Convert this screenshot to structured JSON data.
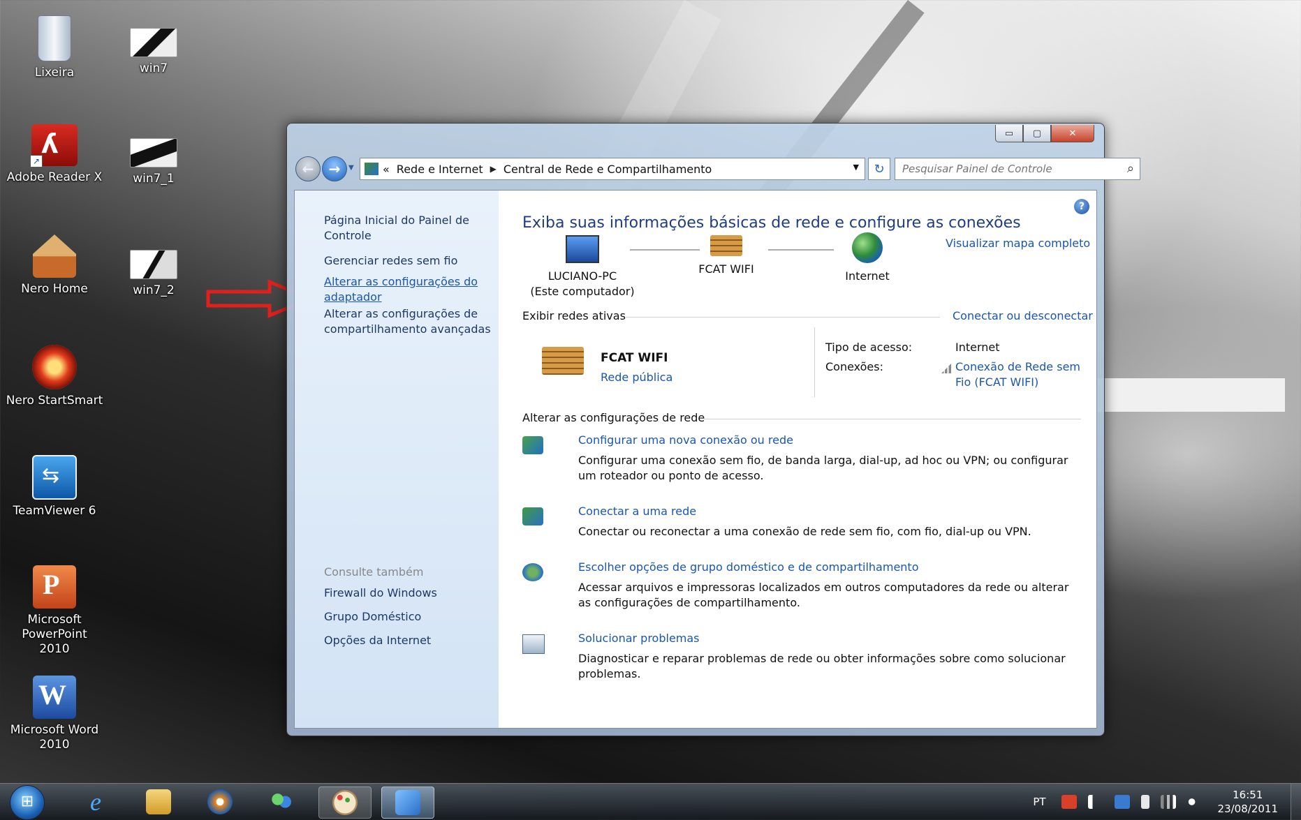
{
  "desktop": {
    "icons": [
      {
        "label": "Lixeira",
        "icon": "recycle-bin-icon"
      },
      {
        "label": "win7",
        "icon": "image-file-icon"
      },
      {
        "label": "Adobe Reader X",
        "icon": "adobe-reader-icon"
      },
      {
        "label": "win7_1",
        "icon": "image-file-icon"
      },
      {
        "label": "Nero Home",
        "icon": "nero-home-icon"
      },
      {
        "label": "win7_2",
        "icon": "image-file-icon"
      },
      {
        "label": "Nero StartSmart",
        "icon": "nero-startsmart-icon"
      },
      {
        "label": "TeamViewer 6",
        "icon": "teamviewer-icon"
      },
      {
        "label": "Microsoft PowerPoint 2010",
        "icon": "powerpoint-icon"
      },
      {
        "label": "Microsoft Word 2010",
        "icon": "word-icon"
      }
    ]
  },
  "window": {
    "address": {
      "prefix": "«",
      "crumbs": [
        "Rede e Internet",
        "Central de Rede e Compartilhamento"
      ]
    },
    "search_placeholder": "Pesquisar Painel de Controle",
    "left_pane": {
      "home": "Página Inicial do Painel de Controle",
      "links": [
        "Gerenciar redes sem fio",
        "Alterar as configurações do adaptador",
        "Alterar as configurações de compartilhamento avançadas"
      ],
      "see_also_title": "Consulte também",
      "see_also": [
        "Firewall do Windows",
        "Grupo Doméstico",
        "Opções da Internet"
      ]
    },
    "main": {
      "title": "Exiba suas informações básicas de rede e configure as conexões",
      "view_full_map": "Visualizar mapa completo",
      "map_nodes": [
        {
          "name": "LUCIANO-PC",
          "sub": "(Este computador)"
        },
        {
          "name": "FCAT WIFI",
          "sub": ""
        },
        {
          "name": "Internet",
          "sub": ""
        }
      ],
      "active_networks_label": "Exibir redes ativas",
      "connect_disconnect": "Conectar ou desconectar",
      "network": {
        "name": "FCAT WIFI",
        "type": "Rede pública",
        "access_type_label": "Tipo de acesso:",
        "access_type_value": "Internet",
        "connections_label": "Conexões:",
        "connection_value": "Conexão de Rede sem Fio (FCAT WIFI)"
      },
      "change_settings_label": "Alterar as configurações de rede",
      "tasks": [
        {
          "link": "Configurar uma nova conexão ou rede",
          "desc": "Configurar uma conexão sem fio, de banda larga, dial-up, ad hoc ou VPN; ou configurar um roteador ou ponto de acesso."
        },
        {
          "link": "Conectar a uma rede",
          "desc": "Conectar ou reconectar a uma conexão de rede sem fio, com fio, dial-up ou VPN."
        },
        {
          "link": "Escolher opções de grupo doméstico e de compartilhamento",
          "desc": "Acessar arquivos e impressoras localizados em outros computadores da rede ou alterar as configurações de compartilhamento."
        },
        {
          "link": "Solucionar problemas",
          "desc": "Diagnosticar e reparar problemas de rede ou obter informações sobre como solucionar problemas."
        }
      ]
    }
  },
  "taskbar": {
    "language": "PT",
    "time": "16:51",
    "date": "23/08/2011"
  },
  "colors": {
    "link": "#1a56b0",
    "title": "#1e3d82",
    "annotation_arrow": "#e0201c"
  }
}
